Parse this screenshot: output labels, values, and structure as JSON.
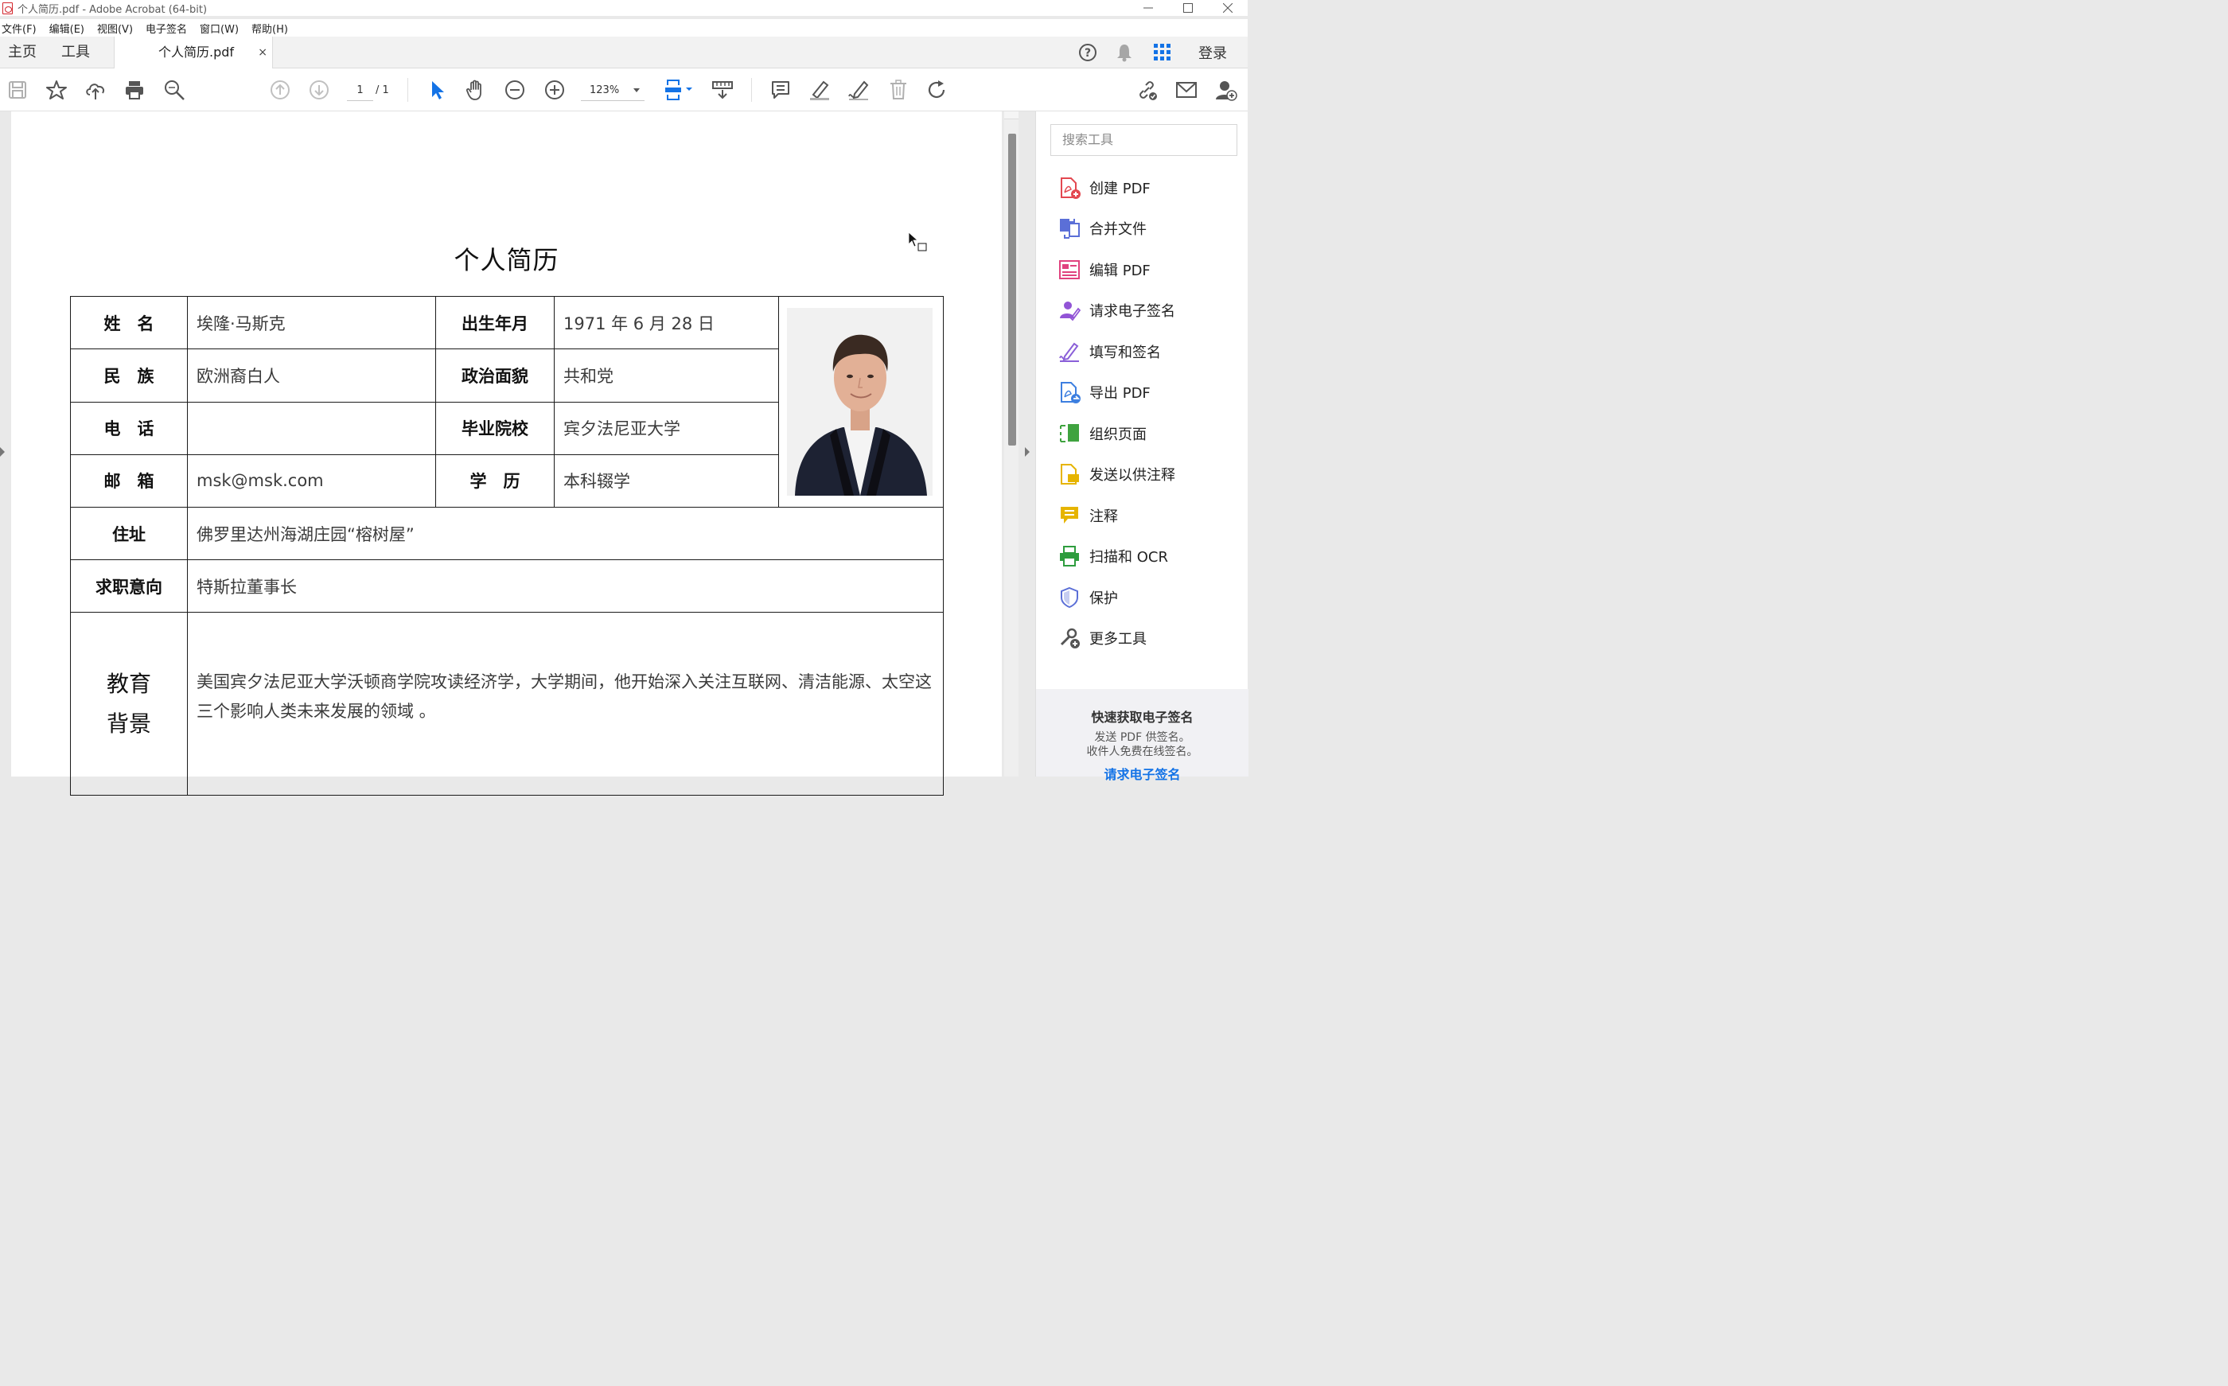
{
  "window": {
    "title": "个人简历.pdf - Adobe Acrobat (64-bit)",
    "controls": [
      "minimize",
      "maximize",
      "close"
    ]
  },
  "menu": {
    "items": [
      "文件(F)",
      "编辑(E)",
      "视图(V)",
      "电子签名",
      "窗口(W)",
      "帮助(H)"
    ]
  },
  "tabs": {
    "home": "主页",
    "tools": "工具",
    "document": "个人简历.pdf",
    "close": "×",
    "login": "登录"
  },
  "toolbar": {
    "page_current": "1",
    "page_total": "/ 1",
    "zoom": "123%",
    "icons": [
      "save-icon",
      "star-icon",
      "upload-icon",
      "print-icon",
      "zoom-search-icon",
      "page-up-icon",
      "page-down-icon",
      "select-cursor-icon",
      "hand-icon",
      "zoom-out-icon",
      "zoom-in-icon",
      "fit-page-icon",
      "scroll-mode-icon",
      "comment-icon",
      "highlight-icon",
      "sign-icon",
      "delete-icon",
      "rotate-icon",
      "link-icon",
      "email-icon",
      "add-user-icon"
    ]
  },
  "document": {
    "title": "个人简历",
    "rows": [
      {
        "l1": "姓　名",
        "v1": "埃隆·马斯克",
        "l2": "出生年月",
        "v2": "1971 年 6 月 28 日"
      },
      {
        "l1": "民　族",
        "v1": "欧洲裔白人",
        "l2": "政治面貌",
        "v2": "共和党"
      },
      {
        "l1": "电　话",
        "v1": "",
        "l2": "毕业院校",
        "v2": "宾夕法尼亚大学"
      },
      {
        "l1": "邮　箱",
        "v1": "msk@msk.com",
        "l2": "学　历",
        "v2": "本科辍学"
      }
    ],
    "address": {
      "label": "住址",
      "value": "佛罗里达州海湖庄园“榕树屋”"
    },
    "intent": {
      "label": "求职意向",
      "value": "特斯拉董事长"
    },
    "education": {
      "label_line1": "教育",
      "label_line2": "背景",
      "value": "美国宾夕法尼亚大学沃顿商学院攻读经济学，大学期间，他开始深入关注互联网、清洁能源、太空这三个影响人类未来发展的领域 。"
    }
  },
  "toolpane": {
    "search_placeholder": "搜索工具",
    "tools": [
      {
        "label": "创建 PDF",
        "icon": "create-pdf-icon",
        "color": "#e34850"
      },
      {
        "label": "合并文件",
        "icon": "combine-files-icon",
        "color": "#5b6fd7"
      },
      {
        "label": "编辑 PDF",
        "icon": "edit-pdf-icon",
        "color": "#e0427e"
      },
      {
        "label": "请求电子签名",
        "icon": "request-esign-icon",
        "color": "#9254d6"
      },
      {
        "label": "填写和签名",
        "icon": "fill-sign-icon",
        "color": "#8a5fd8"
      },
      {
        "label": "导出 PDF",
        "icon": "export-pdf-icon",
        "color": "#3d7fe0"
      },
      {
        "label": "组织页面",
        "icon": "organize-pages-icon",
        "color": "#3fa33f"
      },
      {
        "label": "发送以供注释",
        "icon": "send-comment-icon",
        "color": "#e6b400"
      },
      {
        "label": "注释",
        "icon": "comment-tool-icon",
        "color": "#e6b400"
      },
      {
        "label": "扫描和 OCR",
        "icon": "scan-ocr-icon",
        "color": "#2e9d3e"
      },
      {
        "label": "保护",
        "icon": "protect-icon",
        "color": "#5b6fd7"
      },
      {
        "label": "更多工具",
        "icon": "more-tools-icon",
        "color": "#444444"
      }
    ],
    "promo": {
      "heading": "快速获取电子签名",
      "line1": "发送 PDF 供签名。",
      "line2": "收件人免费在线签名。",
      "link": "请求电子签名"
    }
  }
}
